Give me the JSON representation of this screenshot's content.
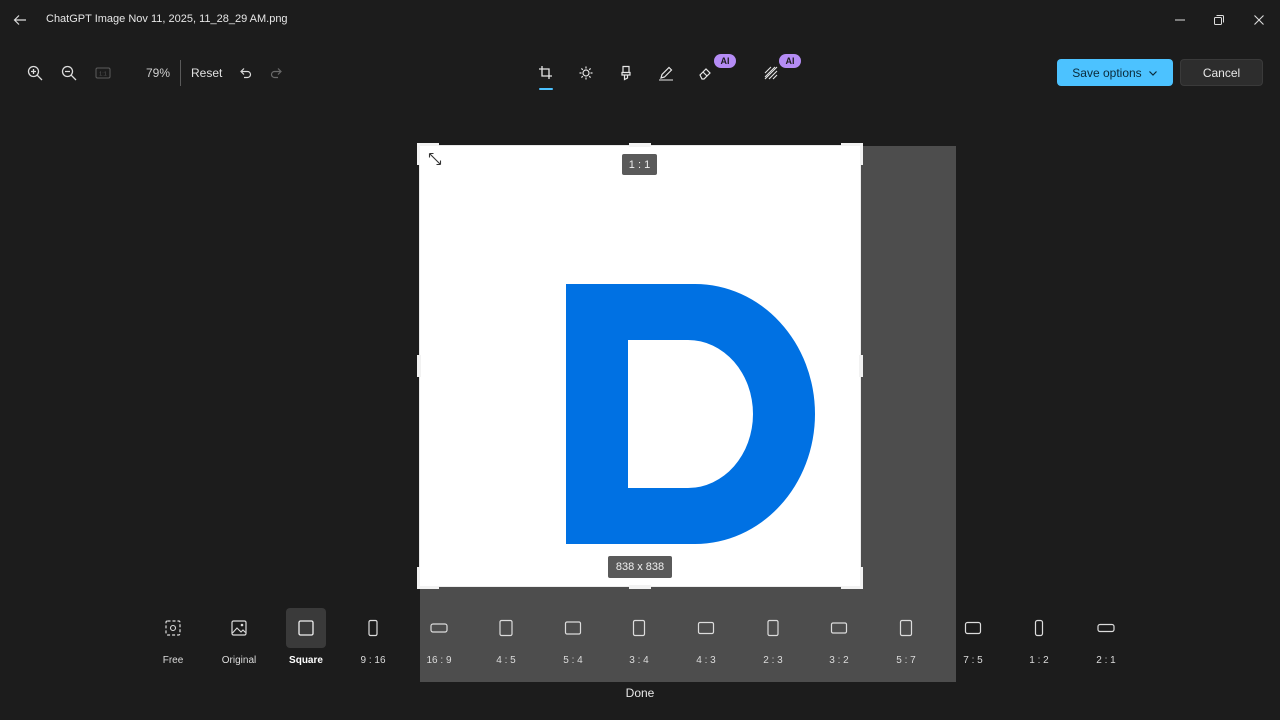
{
  "window": {
    "title": "ChatGPT Image Nov 11, 2025, 11_28_29 AM.png"
  },
  "toolbar": {
    "zoom_level": "79%",
    "reset_label": "Reset"
  },
  "tools": [
    {
      "name": "crop",
      "icon": "crop-icon",
      "active": true
    },
    {
      "name": "adjust",
      "icon": "brightness-icon"
    },
    {
      "name": "filter",
      "icon": "marker-icon"
    },
    {
      "name": "markup",
      "icon": "pen-icon"
    },
    {
      "name": "erase",
      "icon": "eraser-icon",
      "badge": "AI"
    },
    {
      "name": "background",
      "icon": "background-icon",
      "badge": "AI"
    }
  ],
  "actions": {
    "save_label": "Save options",
    "cancel_label": "Cancel"
  },
  "canvas": {
    "ratio_label": "1 : 1",
    "size_label": "838 x 838",
    "image_letter": "D",
    "letter_color": "#0071e3"
  },
  "ratios": [
    {
      "label": "Free",
      "icon": "free-crop-icon"
    },
    {
      "label": "Original",
      "icon": "original-image-icon"
    },
    {
      "label": "Square",
      "icon": "square-icon",
      "selected": true
    },
    {
      "label": "9 : 16",
      "icon": "portrait-9-16-icon"
    },
    {
      "label": "16 : 9",
      "icon": "landscape-16-9-icon"
    },
    {
      "label": "4 : 5",
      "icon": "portrait-4-5-icon"
    },
    {
      "label": "5 : 4",
      "icon": "landscape-5-4-icon"
    },
    {
      "label": "3 : 4",
      "icon": "portrait-3-4-icon"
    },
    {
      "label": "4 : 3",
      "icon": "landscape-4-3-icon"
    },
    {
      "label": "2 : 3",
      "icon": "portrait-2-3-icon"
    },
    {
      "label": "3 : 2",
      "icon": "landscape-3-2-icon"
    },
    {
      "label": "5 : 7",
      "icon": "portrait-5-7-icon"
    },
    {
      "label": "7 : 5",
      "icon": "landscape-7-5-icon"
    },
    {
      "label": "1 : 2",
      "icon": "portrait-1-2-icon"
    },
    {
      "label": "2 : 1",
      "icon": "landscape-2-1-icon"
    }
  ],
  "done_label": "Done",
  "colors": {
    "accent": "#4cc2ff",
    "ai_badge": "#b58cf5",
    "background": "#1c1c1c"
  }
}
